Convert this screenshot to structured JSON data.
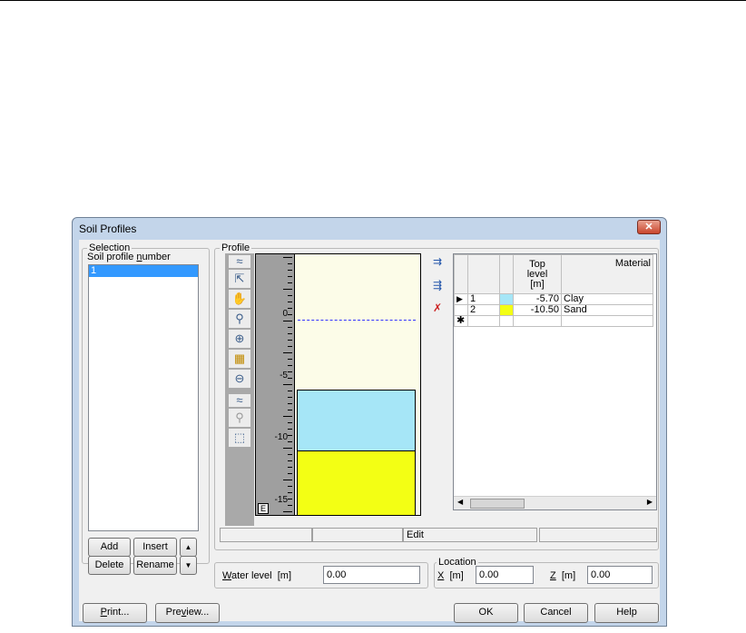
{
  "window": {
    "title": "Soil Profiles",
    "close_label": "✕"
  },
  "selection": {
    "group_label": "Selection",
    "list_label": "Soil profile number",
    "items": [
      "1"
    ],
    "add": "Add",
    "insert": "Insert",
    "delete": "Delete",
    "rename": "Rename",
    "up": "▲",
    "down": "▼"
  },
  "profile": {
    "group_label": "Profile",
    "ruler_ticks": [
      "0",
      "-5",
      "-10",
      "-15"
    ],
    "ruler_mode": "E",
    "tools": [
      "chevron-up-icon",
      "pointer-icon",
      "hand-icon",
      "measure-icon",
      "zoom-in-icon",
      "zoom-rect-icon",
      "zoom-out-icon",
      "chevron-up-icon",
      "zoom-reset-icon",
      "fit-icon"
    ],
    "layers": [
      {
        "color": "#a6e6f7"
      },
      {
        "color": "#f3ff14"
      }
    ],
    "table": {
      "headers": [
        "",
        "",
        "Top\nlevel\n[m]",
        "Material"
      ],
      "rows": [
        {
          "marker": "▶",
          "num": "1",
          "color": "#a6e6f7",
          "top": "-5.70",
          "material": "Clay"
        },
        {
          "marker": "",
          "num": "2",
          "color": "#f3ff14",
          "top": "-10.50",
          "material": "Sand"
        }
      ],
      "new_row_marker": "✱"
    },
    "status_mode": "Edit"
  },
  "water_level": {
    "label": "Water level",
    "unit": "[m]",
    "value": "0.00"
  },
  "location": {
    "group_label": "Location",
    "x_label": "X",
    "x_unit": "[m]",
    "x_value": "0.00",
    "z_label": "Z",
    "z_unit": "[m]",
    "z_value": "0.00"
  },
  "buttons": {
    "print": "Print...",
    "preview": "Preview...",
    "ok": "OK",
    "cancel": "Cancel",
    "help": "Help"
  }
}
